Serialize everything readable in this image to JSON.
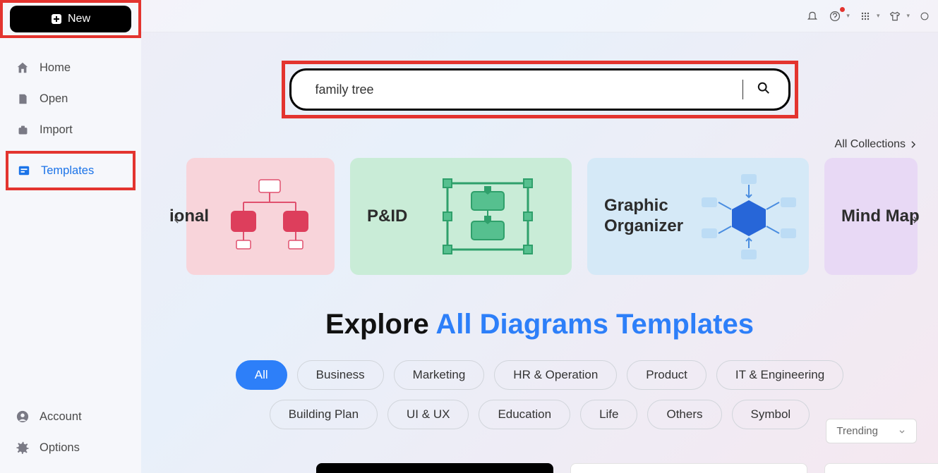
{
  "sidebar": {
    "new_label": "New",
    "items": [
      {
        "label": "Home"
      },
      {
        "label": "Open"
      },
      {
        "label": "Import"
      },
      {
        "label": "Templates"
      }
    ],
    "bottom": [
      {
        "label": "Account"
      },
      {
        "label": "Options"
      }
    ]
  },
  "search": {
    "value": "family tree"
  },
  "allCollections": "All Collections",
  "cards": [
    {
      "label": "ional"
    },
    {
      "label": "P&ID"
    },
    {
      "label_a": "Graphic",
      "label_b": "Organizer"
    },
    {
      "label": "Mind Map"
    }
  ],
  "headline": {
    "text_a": "Explore ",
    "text_b": "All Diagrams Templates"
  },
  "pills": [
    "All",
    "Business",
    "Marketing",
    "HR & Operation",
    "Product",
    "IT & Engineering",
    "Building Plan",
    "UI & UX",
    "Education",
    "Life",
    "Others",
    "Symbol"
  ],
  "sort": {
    "label": "Trending"
  }
}
